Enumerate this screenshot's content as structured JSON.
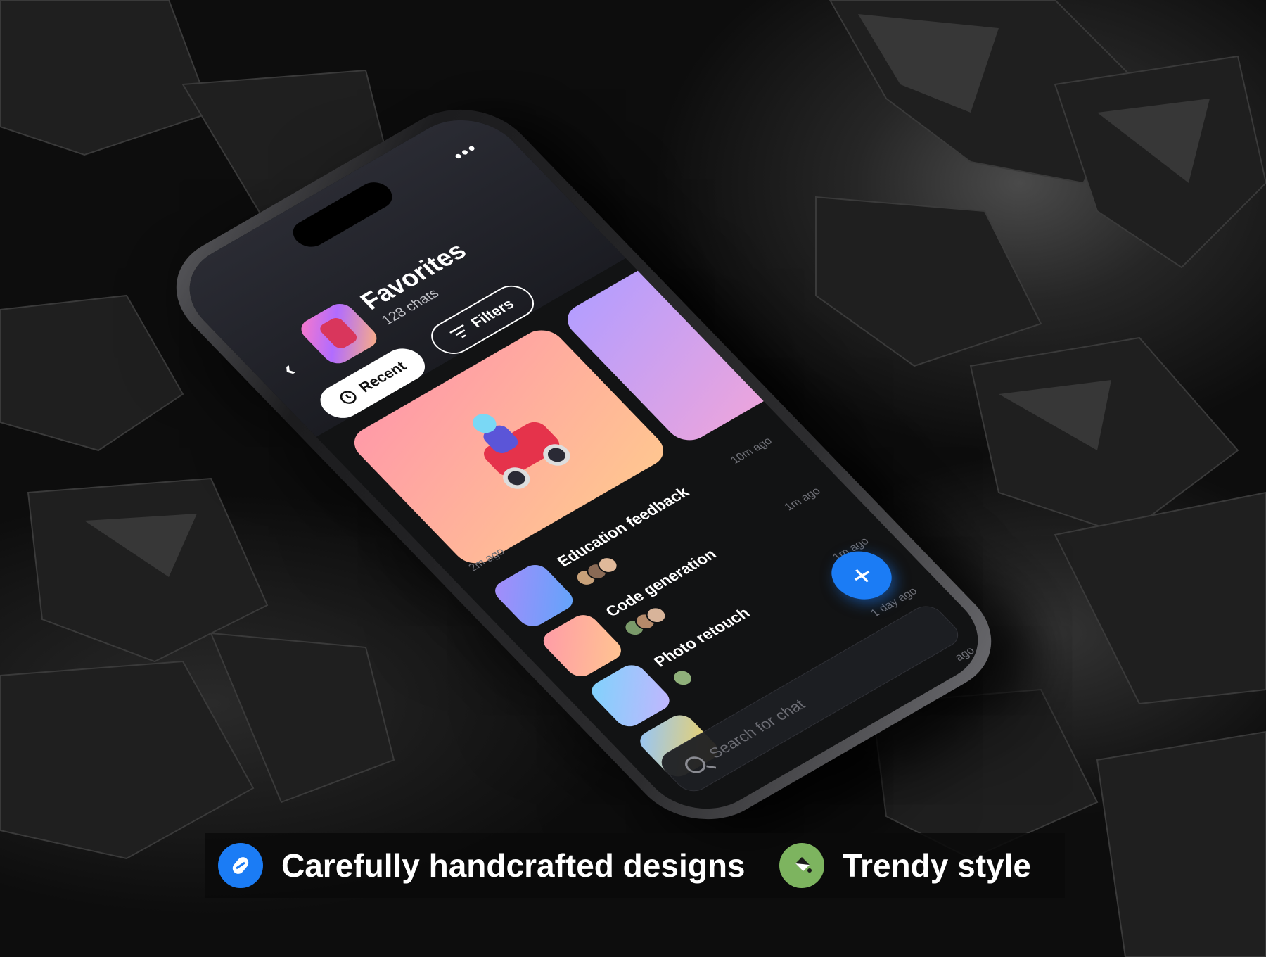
{
  "app": {
    "title": "Favorites",
    "subtitle": "128 chats",
    "more_label": "•••",
    "back_label": "‹"
  },
  "chips": {
    "recent": "Recent",
    "filters": "Filters"
  },
  "chats": [
    {
      "title": "Education feedback",
      "time": "10m ago",
      "avatars": 3,
      "thumb_colors": [
        "#a78bfa",
        "#60a5fa"
      ]
    },
    {
      "title": "Code generation",
      "time": "1m ago",
      "avatars": 3,
      "thumb_colors": [
        "#ff9aa8",
        "#ffc690"
      ]
    },
    {
      "title": "Photo retouch",
      "time": "1m ago",
      "avatars": 1,
      "thumb_colors": [
        "#7dd3fc",
        "#c4b5fd"
      ]
    },
    {
      "title": "",
      "time": "1 day ago",
      "avatars": 0,
      "thumb_colors": [
        "#93c5fd",
        "#fcd34d"
      ]
    }
  ],
  "first_time": "2m ago",
  "last_time": "ago",
  "fab_label": "+",
  "search": {
    "placeholder": "Search for chat"
  },
  "banner": {
    "feature_1": "Carefully handcrafted designs",
    "feature_2": "Trendy style"
  },
  "colors": {
    "accent": "#1b7cf5",
    "green_badge": "#7db45f",
    "screen_bg": "#121314"
  }
}
